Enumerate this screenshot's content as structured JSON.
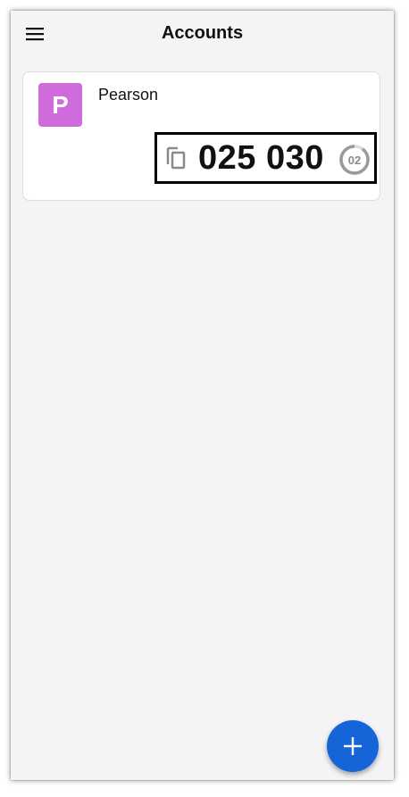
{
  "appbar": {
    "title": "Accounts",
    "menu_icon": "hamburger-menu-icon"
  },
  "accounts": [
    {
      "initial": "P",
      "avatar_color": "#d06bdc",
      "name": "Pearson",
      "code": "025 030",
      "copy_icon": "copy-icon",
      "timer_seconds": "02",
      "timer_progress": 0.1
    }
  ],
  "fab": {
    "icon": "plus-icon",
    "color": "#1565d8"
  }
}
